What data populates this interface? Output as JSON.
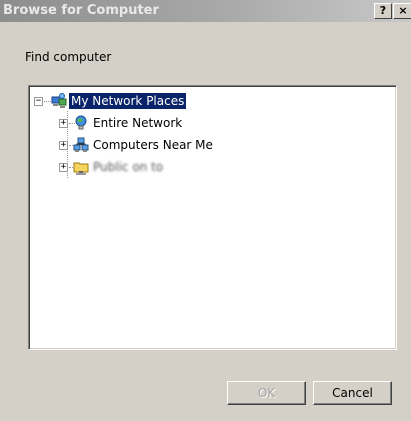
{
  "window": {
    "title": "Browse for Computer",
    "help_label": "?",
    "close_label": "×"
  },
  "prompt": "Find computer",
  "tree": {
    "root": {
      "label": "My Network Places",
      "icon": "network-places-icon",
      "expander": "−"
    },
    "children": [
      {
        "label": "Entire Network",
        "icon": "globe-network-icon",
        "expander": "+"
      },
      {
        "label": "Computers Near Me",
        "icon": "computers-icon",
        "expander": "+"
      },
      {
        "label": "Public on to",
        "icon": "network-share-icon",
        "expander": "+"
      }
    ]
  },
  "buttons": {
    "ok": "OK",
    "cancel": "Cancel"
  }
}
